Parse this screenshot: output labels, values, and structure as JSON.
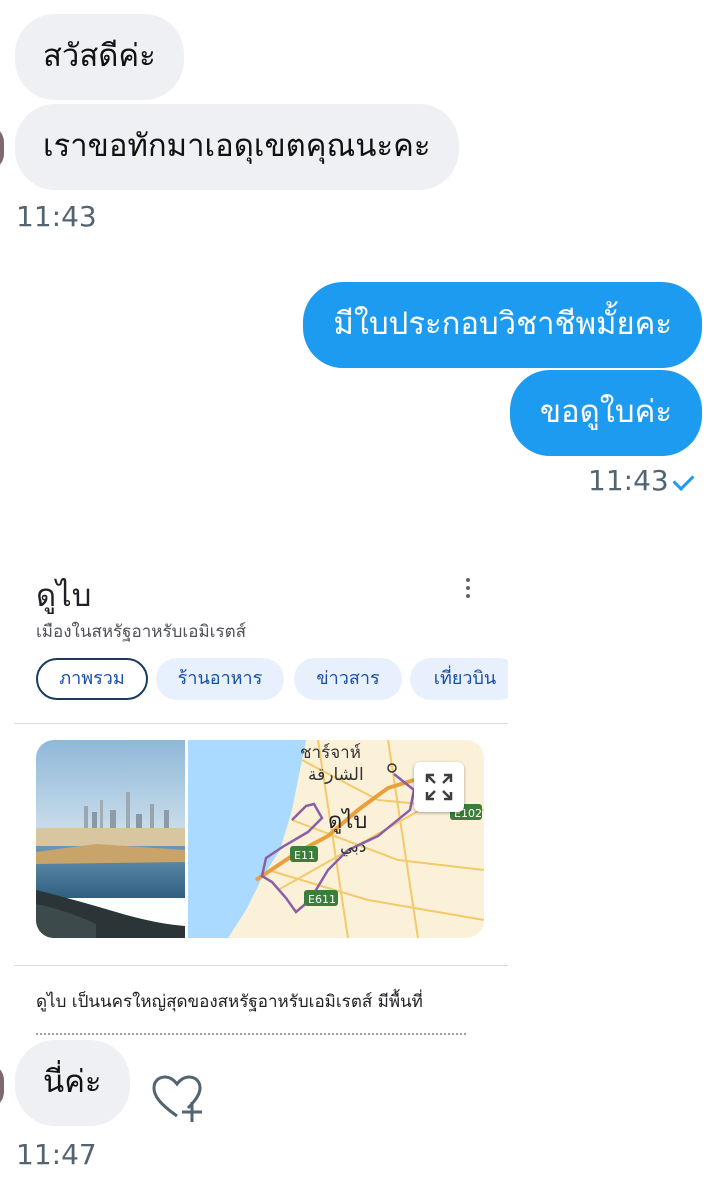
{
  "messages": [
    {
      "text": "สวัสดีค่ะ"
    },
    {
      "text": "เราขอทักมาเอดุเขตคุณนะคะ"
    },
    {
      "text": "มีใบประกอบวิชาชีพมั้ยคะ"
    },
    {
      "text": "ขอดูใบค่ะ"
    },
    {
      "text": "นี่ค่ะ"
    }
  ],
  "times": {
    "first": "11:43",
    "second": "11:43",
    "third": "11:47"
  },
  "card": {
    "title": "ดูไบ",
    "subtitle": "เมืองในสหรัฐอาหรับเอมิเรตส์",
    "chips": [
      "ภาพรวม",
      "ร้านอาหาร",
      "ข่าวสาร",
      "เที่ยวบิน"
    ],
    "map_labels": {
      "city1_th": "ชาร์จาห์",
      "city1_ar": "الشارقة",
      "city2_th": "ดูไบ",
      "city2_ar": "دبي",
      "road1": "E11",
      "road2": "E611",
      "road3": "E102"
    },
    "description": "ดูไบ เป็นนครใหญ่สุดของสหรัฐอาหรับเอมิเรตส์ มีพื้นที่"
  },
  "colors": {
    "out_bubble": "#1d9bf0",
    "in_bubble": "#eef0f3",
    "chip_bg": "#e8f0fe",
    "chip_text": "#174ea6"
  }
}
